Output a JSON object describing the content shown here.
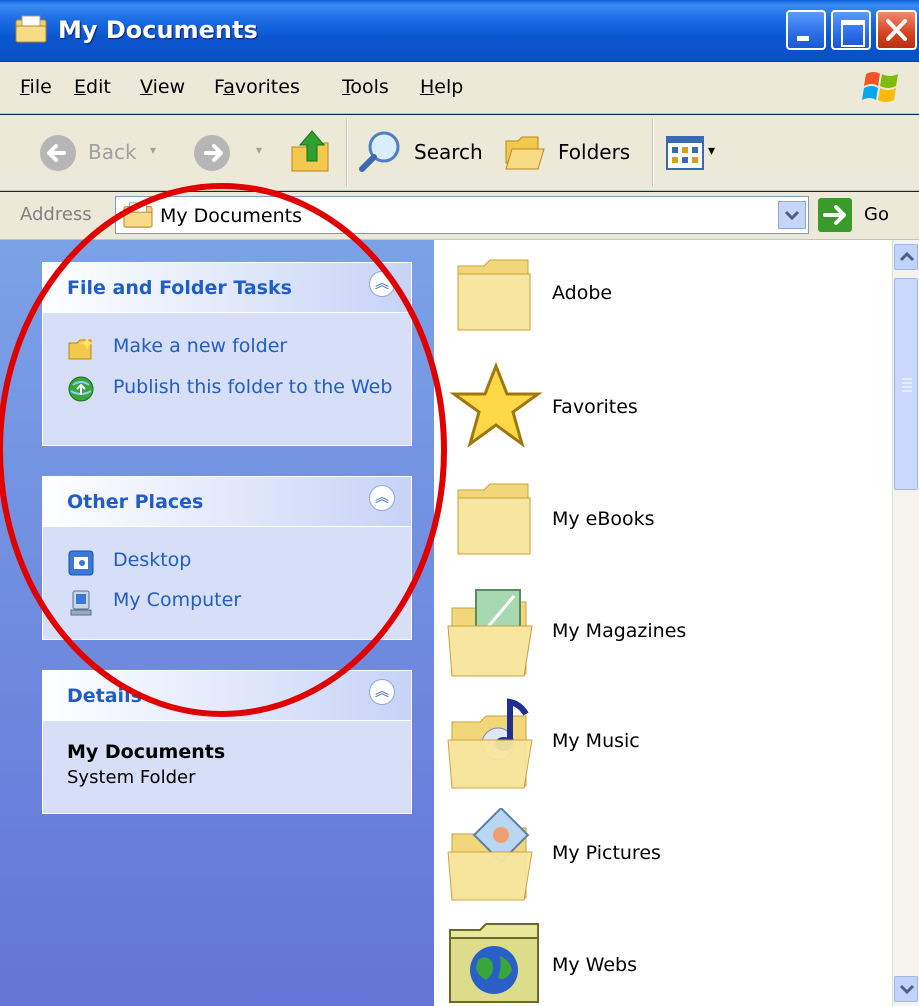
{
  "window": {
    "title": "My Documents"
  },
  "menu": [
    "File",
    "Edit",
    "View",
    "Favorites",
    "Tools",
    "Help"
  ],
  "menu_access": [
    "F",
    "E",
    "V",
    "a",
    "T",
    "H"
  ],
  "toolbar": {
    "back_label": "Back",
    "search_label": "Search",
    "folders_label": "Folders"
  },
  "address": {
    "label": "Address",
    "value": "My Documents",
    "go_label": "Go"
  },
  "panels": {
    "file_tasks": {
      "title": "File and Folder Tasks",
      "items": [
        "Make a new folder",
        "Publish this folder to the Web"
      ]
    },
    "other_places": {
      "title": "Other Places",
      "items": [
        "Desktop",
        "My Computer"
      ]
    },
    "details": {
      "title": "Details",
      "name": "My Documents",
      "type": "System Folder"
    }
  },
  "files": [
    "Adobe",
    "Favorites",
    "My eBooks",
    "My Magazines",
    "My Music",
    "My Pictures",
    "My Webs"
  ],
  "colors": {
    "titlebar": "#0b57d0",
    "task_link": "#215dc6",
    "annotation": "#e00000"
  }
}
